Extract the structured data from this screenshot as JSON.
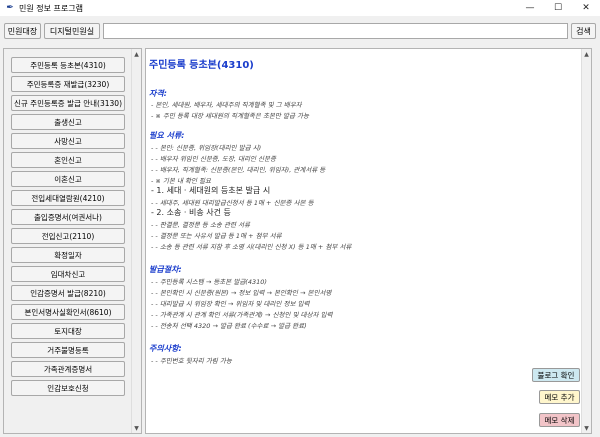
{
  "window": {
    "title": "민원 정보 프로그램",
    "controls": {
      "minimize": "—",
      "maximize": "☐",
      "close": "✕"
    }
  },
  "toolbar": {
    "btn1_label": "민원대장",
    "btn2_label": "디지털민원실",
    "search_value": "",
    "search_button": "검색"
  },
  "sidebar": {
    "items": [
      {
        "label": "주민등록 등초본(4310)"
      },
      {
        "label": "주민등록증 재발급(3230)"
      },
      {
        "label": "신규 주민등록증 발급 안내(3130)"
      },
      {
        "label": "출생신고"
      },
      {
        "label": "사망신고"
      },
      {
        "label": "혼인신고"
      },
      {
        "label": "이혼신고"
      },
      {
        "label": "전입세대열람원(4210)"
      },
      {
        "label": "출입증명서(여권서나)"
      },
      {
        "label": "전입신고(2110)"
      },
      {
        "label": "확정일자"
      },
      {
        "label": "임대차신고"
      },
      {
        "label": "인감증명서 발급(8210)"
      },
      {
        "label": "본인서명사실확인서(8610)"
      },
      {
        "label": "토지대장"
      },
      {
        "label": "거주불명등록"
      },
      {
        "label": "가족관계증명서"
      },
      {
        "label": "인감보호신청"
      }
    ]
  },
  "document": {
    "title": "주민등록 등초본(4310)",
    "sections": [
      {
        "heading": "자격:",
        "lines": [
          "- 본인, 세대원, 배우자, 세대주의 직계혈족 및 그 배우자",
          "- ※ 주민 등록 대장 세대원의 직계혈족은 초본만 발급 가능"
        ]
      },
      {
        "heading": "필요 서류:",
        "lines": [
          "- - 본인: 신분증, 위임장(대리인 발급 시)",
          "- - 배우자 위임인 신분증, 도장, 대리인 신분증",
          "- - 배우자, 직계혈족: 신분증(본인, 대리인, 위임자), 관계서류 등",
          "- ※ 기본 내 확인 필요",
          "- 1. 세대 · 세대원의 등초본 발급 시",
          "- - 세대주, 세대원 대리발급신청서 등 1매 + 신분증 사본 등",
          "- 2. 소송 · 비송 사건 등",
          "- - 판결문, 결정문 등 소송 관련 서류",
          "- - 결정문 또는 사유서 발급 등 1매 + 첨부 서류",
          "- - 소송 등 관련 서류 지참 후 소명 시(대리인 신청 X) 등 1매 + 첨부 서류"
        ]
      },
      {
        "heading": "발급절차:",
        "lines": [
          "- - 주민등록 시스템 → 등초본 발급(4310)",
          "- - 본인확인 시 신분증(원본) → 정보 입력 → 본인확인 → 본인서명",
          "- - 대리발급 시 위임장 확인 → 위임자 및 대리인 정보 입력",
          "- - 가족관계 시 관계 확인 서류(가족관계) → 신청인 및 대상자 입력",
          "- - 전송처 선택 4320 → 발급 완료 (수수료 → 발급 완료)"
        ]
      },
      {
        "heading": "주의사항:",
        "lines": [
          "- - 주민번호 뒷자리 가림 가능"
        ]
      }
    ]
  },
  "actions": {
    "log_check": "불로그 확인",
    "memo_add": "메모 추가",
    "memo_delete": "메모 삭제"
  },
  "colors": {
    "heading_blue": "#1a3dcc",
    "log_btn": "#cde8f0",
    "memo_add_btn": "#fff6cc",
    "memo_delete_btn": "#f2c4c8"
  }
}
